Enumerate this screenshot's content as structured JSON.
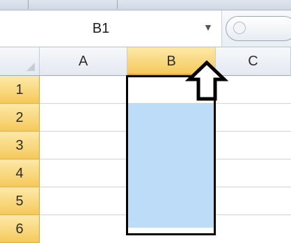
{
  "name_box": {
    "cell_ref": "B1"
  },
  "columns": [
    {
      "label": "A",
      "selected": false
    },
    {
      "label": "B",
      "selected": true
    },
    {
      "label": "C",
      "selected": false
    }
  ],
  "rows": [
    "1",
    "2",
    "3",
    "4",
    "5",
    "6"
  ],
  "icons": {
    "dropdown": "chevron-down-icon",
    "fx": "insert-function-icon",
    "select_all": "select-all-icon",
    "pointer": "up-arrow-icon"
  },
  "colors": {
    "selection_fill": "#bcdcf8",
    "header_highlight": "#f4c95b",
    "selection_border": "#000000"
  }
}
